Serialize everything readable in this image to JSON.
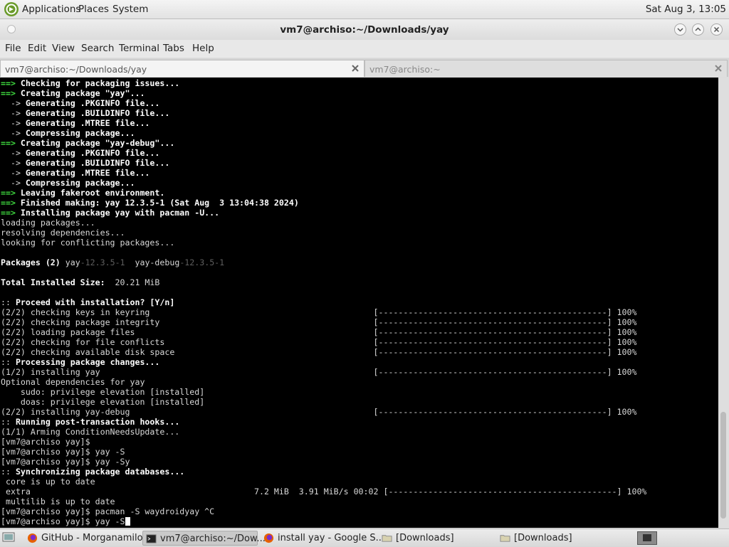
{
  "top_panel": {
    "menus": [
      "Applications",
      "Places",
      "System"
    ],
    "clock": "Sat Aug  3, 13:05"
  },
  "window": {
    "title": "vm7@archiso:~/Downloads/yay"
  },
  "menubar": [
    "File",
    "Edit",
    "View",
    "Search",
    "Terminal",
    "Tabs",
    "Help"
  ],
  "tabs": [
    {
      "label": "vm7@archiso:~/Downloads/yay",
      "active": true
    },
    {
      "label": "vm7@archiso:~",
      "active": false
    }
  ],
  "terminal": {
    "lines": [
      [
        [
          "g",
          "==> "
        ],
        [
          "b",
          "Checking for packaging issues..."
        ]
      ],
      [
        [
          "g",
          "==> "
        ],
        [
          "b",
          "Creating package \"yay\"..."
        ]
      ],
      [
        [
          "w",
          "  -> "
        ],
        [
          "b",
          "Generating .PKGINFO file..."
        ]
      ],
      [
        [
          "w",
          "  -> "
        ],
        [
          "b",
          "Generating .BUILDINFO file..."
        ]
      ],
      [
        [
          "w",
          "  -> "
        ],
        [
          "b",
          "Generating .MTREE file..."
        ]
      ],
      [
        [
          "w",
          "  -> "
        ],
        [
          "b",
          "Compressing package..."
        ]
      ],
      [
        [
          "g",
          "==> "
        ],
        [
          "b",
          "Creating package \"yay-debug\"..."
        ]
      ],
      [
        [
          "w",
          "  -> "
        ],
        [
          "b",
          "Generating .PKGINFO file..."
        ]
      ],
      [
        [
          "w",
          "  -> "
        ],
        [
          "b",
          "Generating .BUILDINFO file..."
        ]
      ],
      [
        [
          "w",
          "  -> "
        ],
        [
          "b",
          "Generating .MTREE file..."
        ]
      ],
      [
        [
          "w",
          "  -> "
        ],
        [
          "b",
          "Compressing package..."
        ]
      ],
      [
        [
          "g",
          "==> "
        ],
        [
          "b",
          "Leaving fakeroot environment."
        ]
      ],
      [
        [
          "g",
          "==> "
        ],
        [
          "b",
          "Finished making: yay 12.3.5-1 (Sat Aug  3 13:04:38 2024)"
        ]
      ],
      [
        [
          "g",
          "==> "
        ],
        [
          "b",
          "Installing package yay with pacman -U..."
        ]
      ],
      [
        [
          "w",
          "loading packages..."
        ]
      ],
      [
        [
          "w",
          "resolving dependencies..."
        ]
      ],
      [
        [
          "w",
          "looking for conflicting packages..."
        ]
      ],
      [
        [
          "w",
          ""
        ]
      ],
      [
        [
          "b",
          "Packages (2) "
        ],
        [
          "w",
          "yay"
        ],
        [
          "d",
          "-12.3.5-1"
        ],
        [
          "w",
          "  yay-debug"
        ],
        [
          "d",
          "-12.3.5-1"
        ]
      ],
      [
        [
          "w",
          ""
        ]
      ],
      [
        [
          "b",
          "Total Installed Size:  "
        ],
        [
          "w",
          "20.21 MiB"
        ]
      ],
      [
        [
          "w",
          ""
        ]
      ],
      [
        [
          "w",
          ":: "
        ],
        [
          "b",
          "Proceed with installation? [Y/n]"
        ]
      ],
      [
        [
          "w",
          "(2/2) checking keys in keyring                                             [----------------------------------------------] 100%"
        ]
      ],
      [
        [
          "w",
          "(2/2) checking package integrity                                           [----------------------------------------------] 100%"
        ]
      ],
      [
        [
          "w",
          "(2/2) loading package files                                                [----------------------------------------------] 100%"
        ]
      ],
      [
        [
          "w",
          "(2/2) checking for file conflicts                                          [----------------------------------------------] 100%"
        ]
      ],
      [
        [
          "w",
          "(2/2) checking available disk space                                        [----------------------------------------------] 100%"
        ]
      ],
      [
        [
          "w",
          ":: "
        ],
        [
          "b",
          "Processing package changes..."
        ]
      ],
      [
        [
          "w",
          "(1/2) installing yay                                                       [----------------------------------------------] 100%"
        ]
      ],
      [
        [
          "w",
          "Optional dependencies for yay"
        ]
      ],
      [
        [
          "w",
          "    sudo: privilege elevation [installed]"
        ]
      ],
      [
        [
          "w",
          "    doas: privilege elevation [installed]"
        ]
      ],
      [
        [
          "w",
          "(2/2) installing yay-debug                                                 [----------------------------------------------] 100%"
        ]
      ],
      [
        [
          "w",
          ":: "
        ],
        [
          "b",
          "Running post-transaction hooks..."
        ]
      ],
      [
        [
          "w",
          "(1/1) Arming ConditionNeedsUpdate..."
        ]
      ],
      [
        [
          "w",
          "[vm7@archiso yay]$"
        ]
      ],
      [
        [
          "w",
          "[vm7@archiso yay]$ yay -S"
        ]
      ],
      [
        [
          "w",
          "[vm7@archiso yay]$ yay -Sy"
        ]
      ],
      [
        [
          "w",
          ":: "
        ],
        [
          "b",
          "Synchronizing package databases..."
        ]
      ],
      [
        [
          "w",
          " core is up to date"
        ]
      ],
      [
        [
          "w",
          " extra                                             7.2 MiB  3.91 MiB/s 00:02 [----------------------------------------------] 100%"
        ]
      ],
      [
        [
          "w",
          " multilib is up to date"
        ]
      ],
      [
        [
          "w",
          "[vm7@archiso yay]$ pacman -S waydroidyay ^C"
        ]
      ],
      [
        [
          "w",
          "[vm7@archiso yay]$ yay -S"
        ]
      ]
    ]
  },
  "taskbar": {
    "items": [
      {
        "label": "GitHub - Morganamilo...",
        "icon": "firefox-icon",
        "active": false
      },
      {
        "label": "vm7@archiso:~/Dow...",
        "icon": "terminal-icon",
        "active": true
      },
      {
        "label": "install yay - Google S...",
        "icon": "firefox-icon",
        "active": false
      },
      {
        "label": "[Downloads]",
        "icon": "folder-icon",
        "active": false
      },
      {
        "label": "[Downloads]",
        "icon": "folder-icon",
        "active": false
      }
    ]
  },
  "colors": {
    "arrow_green": "#3fdc3f",
    "terminal_bg": "#000000"
  }
}
